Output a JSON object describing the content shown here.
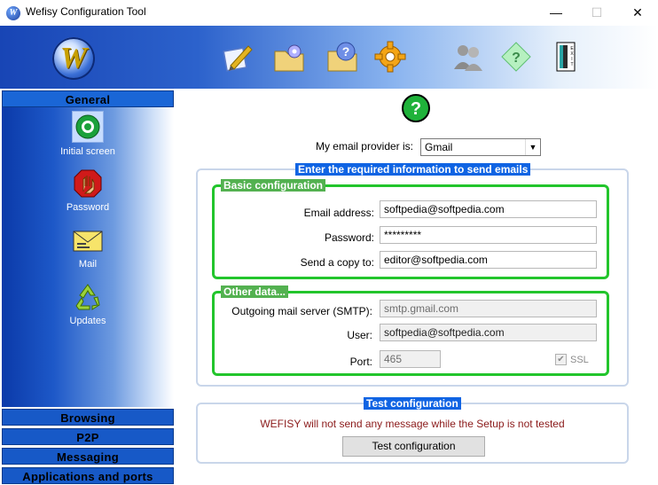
{
  "window": {
    "title": "Wefisy Configuration Tool",
    "minimize": "—",
    "maximize": "☐",
    "close": "✕"
  },
  "toolbar": {
    "logo_letter": "W",
    "icons": [
      "edit-icon",
      "settings-folder-icon",
      "help-folder-icon",
      "gear-icon",
      "users-icon",
      "help-icon",
      "exit-icon"
    ]
  },
  "sidebar": {
    "sections": [
      "General",
      "Browsing",
      "P2P",
      "Messaging",
      "Applications and ports"
    ],
    "items": [
      {
        "label": "Initial screen",
        "icon": "initial-screen-icon"
      },
      {
        "label": "Password",
        "icon": "password-hand-icon"
      },
      {
        "label": "Mail",
        "icon": "mail-envelope-icon"
      },
      {
        "label": "Updates",
        "icon": "updates-recycle-icon"
      }
    ]
  },
  "main": {
    "provider_label": "My email provider is:",
    "provider_value": "Gmail",
    "required_legend": "Enter the required information to send emails",
    "basic": {
      "legend": "Basic configuration",
      "email_label": "Email address:",
      "email_value": "softpedia@softpedia.com",
      "password_label": "Password:",
      "password_value": "*********",
      "copy_label": "Send a copy to:",
      "copy_value": "editor@softpedia.com"
    },
    "other": {
      "legend": "Other data...",
      "smtp_label": "Outgoing mail server (SMTP):",
      "smtp_value": "smtp.gmail.com",
      "user_label": "User:",
      "user_value": "softpedia@softpedia.com",
      "port_label": "Port:",
      "port_value": "465",
      "ssl_label": "SSL"
    },
    "test": {
      "legend": "Test configuration",
      "warning": "WEFISY will not send any message while the Setup is not tested",
      "button": "Test configuration"
    }
  },
  "colors": {
    "accent_blue": "#1064e3",
    "group_green": "#22c52c",
    "warning_text": "#8b1a1a"
  }
}
